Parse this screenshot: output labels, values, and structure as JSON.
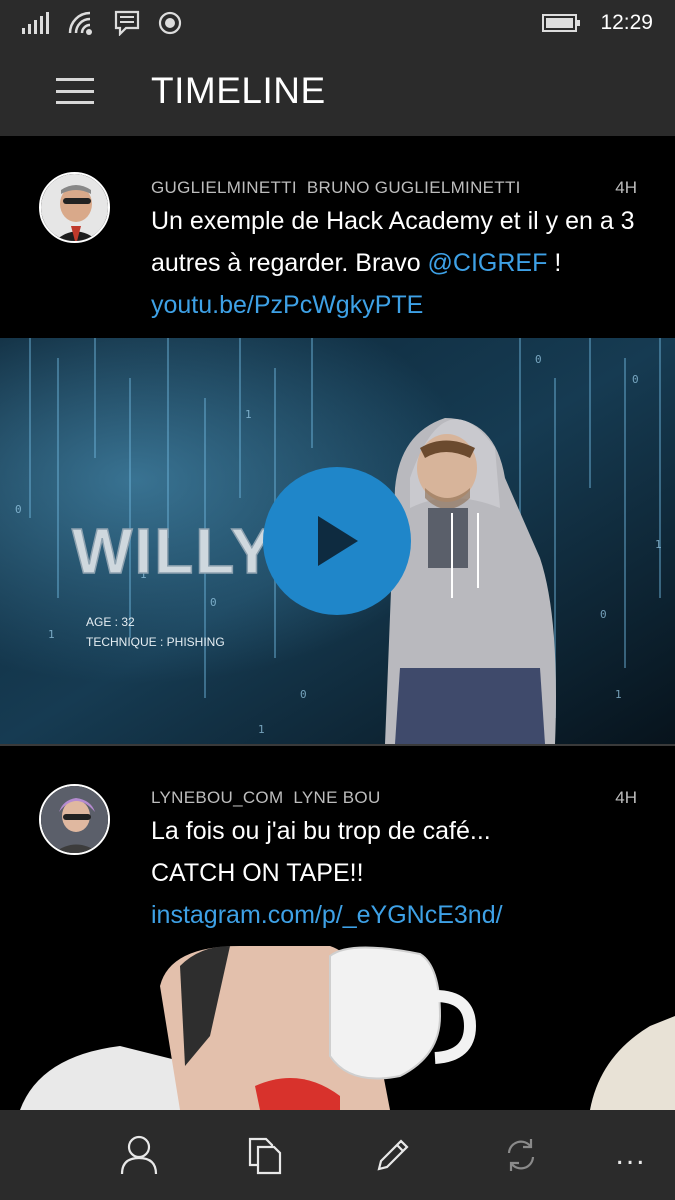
{
  "status_bar": {
    "time": "12:29",
    "icons": [
      "signal-icon",
      "wifi-icon",
      "message-icon",
      "record-icon",
      "battery-icon"
    ]
  },
  "header": {
    "menu_icon": "hamburger-icon",
    "title": "TIMELINE"
  },
  "tweets": [
    {
      "handle": "GUGLIELMINETTI",
      "name": "BRUNO GUGLIELMINETTI",
      "age": "4H",
      "text_parts": {
        "line_main": "Un exemple de Hack Academy et il y en a 3 autres à regarder. Bravo ",
        "mention": "@CIGREF",
        "separator": " ! ",
        "url": "youtu.be/PzPcWgkyPTE"
      },
      "media": {
        "type": "video",
        "overlay_title": "WILLY",
        "overlay_age": "AGE : 32",
        "overlay_technique": "TECHNIQUE : PHISHING"
      }
    },
    {
      "handle": "LYNEBOU_COM",
      "name": "LYNE BOU",
      "age": "4H",
      "text_parts": {
        "line_main": "La fois ou j'ai bu trop de café... CATCH ON TAPE!!",
        "url": "instagram.com/p/_eYGNcE3nd/"
      },
      "media": {
        "type": "image"
      }
    }
  ],
  "app_bar": {
    "buttons": [
      "profile-icon",
      "pages-icon",
      "compose-icon",
      "refresh-icon"
    ],
    "more": "..."
  },
  "colors": {
    "link": "#3ea1e6",
    "play_button": "#1f86c9",
    "chrome": "#2b2b2b"
  }
}
